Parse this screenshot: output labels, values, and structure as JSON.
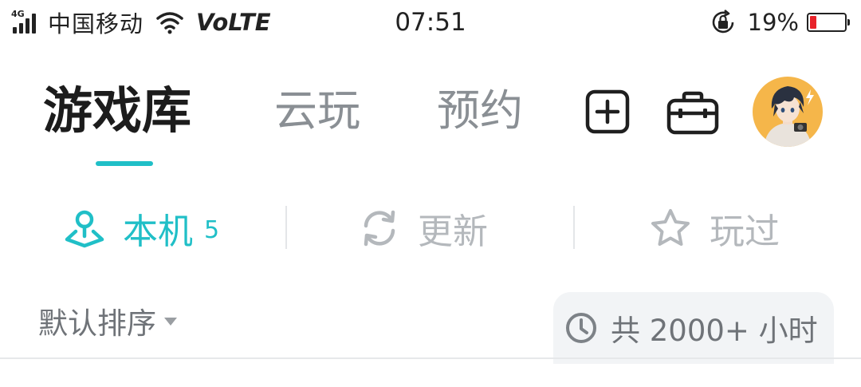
{
  "status_bar": {
    "network": "4G",
    "carrier": "中国移动",
    "volte": "VoLTE",
    "time": "07:51",
    "battery_percent": "19%",
    "battery_level": 0.19,
    "battery_color": "#e8232a"
  },
  "nav": {
    "tabs": [
      {
        "label": "游戏库",
        "active": true
      },
      {
        "label": "云玩",
        "active": false
      },
      {
        "label": "预约",
        "active": false
      }
    ],
    "accent": "#20bfc7",
    "add_icon": "plus-square-icon",
    "toolbox_icon": "toolbox-icon",
    "avatar_icon": "user-avatar"
  },
  "sub_tabs": [
    {
      "label": "本机",
      "count": "5",
      "icon": "location-pin-icon",
      "active": true
    },
    {
      "label": "更新",
      "icon": "refresh-icon",
      "active": false
    },
    {
      "label": "玩过",
      "icon": "star-icon",
      "active": false
    }
  ],
  "sort": {
    "label": "默认排序",
    "playtime": "共 2000+ 小时",
    "playtime_icon": "clock-icon"
  }
}
